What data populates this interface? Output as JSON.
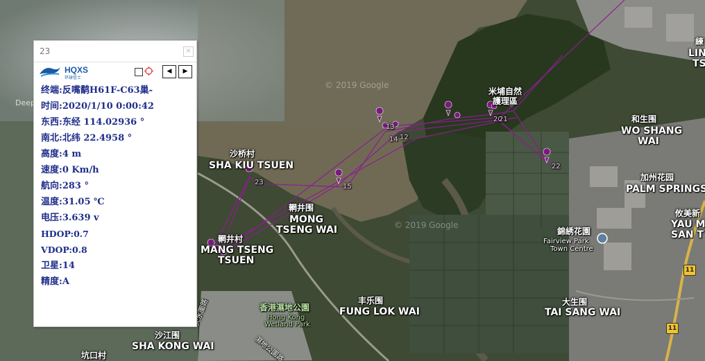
{
  "info_window": {
    "title": "23",
    "close_glyph": "×",
    "logo": {
      "text": "HQXS",
      "sub": "环球信士"
    },
    "controls": {
      "prev_glyph": "◀",
      "next_glyph": "▶",
      "icons": [
        "checkbox-icon",
        "target-icon"
      ]
    },
    "rows": [
      {
        "label": "终端:",
        "value": "反嘴鹬H61F-C63巢-"
      },
      {
        "label": "时间:",
        "value": "2020/1/10 0:00:42"
      },
      {
        "label": "东西:",
        "value": "东经 114.02936 °"
      },
      {
        "label": "南北:",
        "value": "北纬 22.4958 °"
      },
      {
        "label": "高度:",
        "value": "4 m"
      },
      {
        "label": "速度:",
        "value": "0 Km/h"
      },
      {
        "label": "航向:",
        "value": "283 °"
      },
      {
        "label": "温度:",
        "value": "31.05 ℃"
      },
      {
        "label": "电压:",
        "value": "3.639 v"
      },
      {
        "label": "HDOP:",
        "value": "0.7"
      },
      {
        "label": "VDOP:",
        "value": "0.8"
      },
      {
        "label": "卫星:",
        "value": "14"
      },
      {
        "label": "精度:",
        "value": "A"
      }
    ]
  },
  "map": {
    "watermarks": [
      "© 2019 Google",
      "© 2019 Google"
    ],
    "deep_label": "Deep",
    "place_labels": {
      "sha_kiu_zh": "沙桥村",
      "sha_kiu_en": "SHA KIU TSUEN",
      "mong_tseng_wai_zh": "輞井围",
      "mong_tseng_wai_en1": "MONG",
      "mong_tseng_wai_en2": "TSENG WAI",
      "mong_tseng_tsuen_zh": "輞井村",
      "mong_tseng_tsuen_en1": "MANG TSENG",
      "mong_tseng_tsuen_en2": "TSUEN",
      "mai_po_zh1": "米埔自然",
      "mai_po_zh2": "護理區",
      "wo_shang_zh": "和生围",
      "wo_shang_en1": "WO SHANG",
      "wo_shang_en2": "WAI",
      "palm_springs_zh": "加州花园",
      "palm_springs_en": "PALM SPRINGS",
      "yau_mei_zh": "攸美新",
      "yau_mei_en1": "YAU M",
      "yau_mei_en2": "SAN T",
      "fairview_zh": "錦綉花園",
      "fairview_en1": "Fairview Park",
      "fairview_en2": "Town Centre",
      "wetland_zh": "香港濕地公園",
      "wetland_en1": "Hong Kong",
      "wetland_en2": "Wetland Park",
      "fung_lok_zh": "丰乐围",
      "fung_lok_en": "FUNG LOK WAI",
      "tai_sang_zh": "大生围",
      "tai_sang_en": "TAI SANG WAI",
      "sha_kong_zh": "沙江围",
      "sha_kong_en": "SHA KONG WAI",
      "hang_hau_zh": "坑口村",
      "lin_zh": "練",
      "lin_en1": "LIN",
      "lin_en2": "TSU",
      "road_tin_shui": "天水圍路",
      "road_wetland": "濕地公園路"
    },
    "highway_shield": "11",
    "track_labels": [
      "13",
      "14",
      "12",
      "15",
      "20",
      "21",
      "22",
      "23"
    ],
    "colors": {
      "track": "#8a1f8f",
      "pin": "#7b1a7e",
      "panel_text": "#1e2d8a",
      "logo": "#1b5aa5"
    }
  }
}
